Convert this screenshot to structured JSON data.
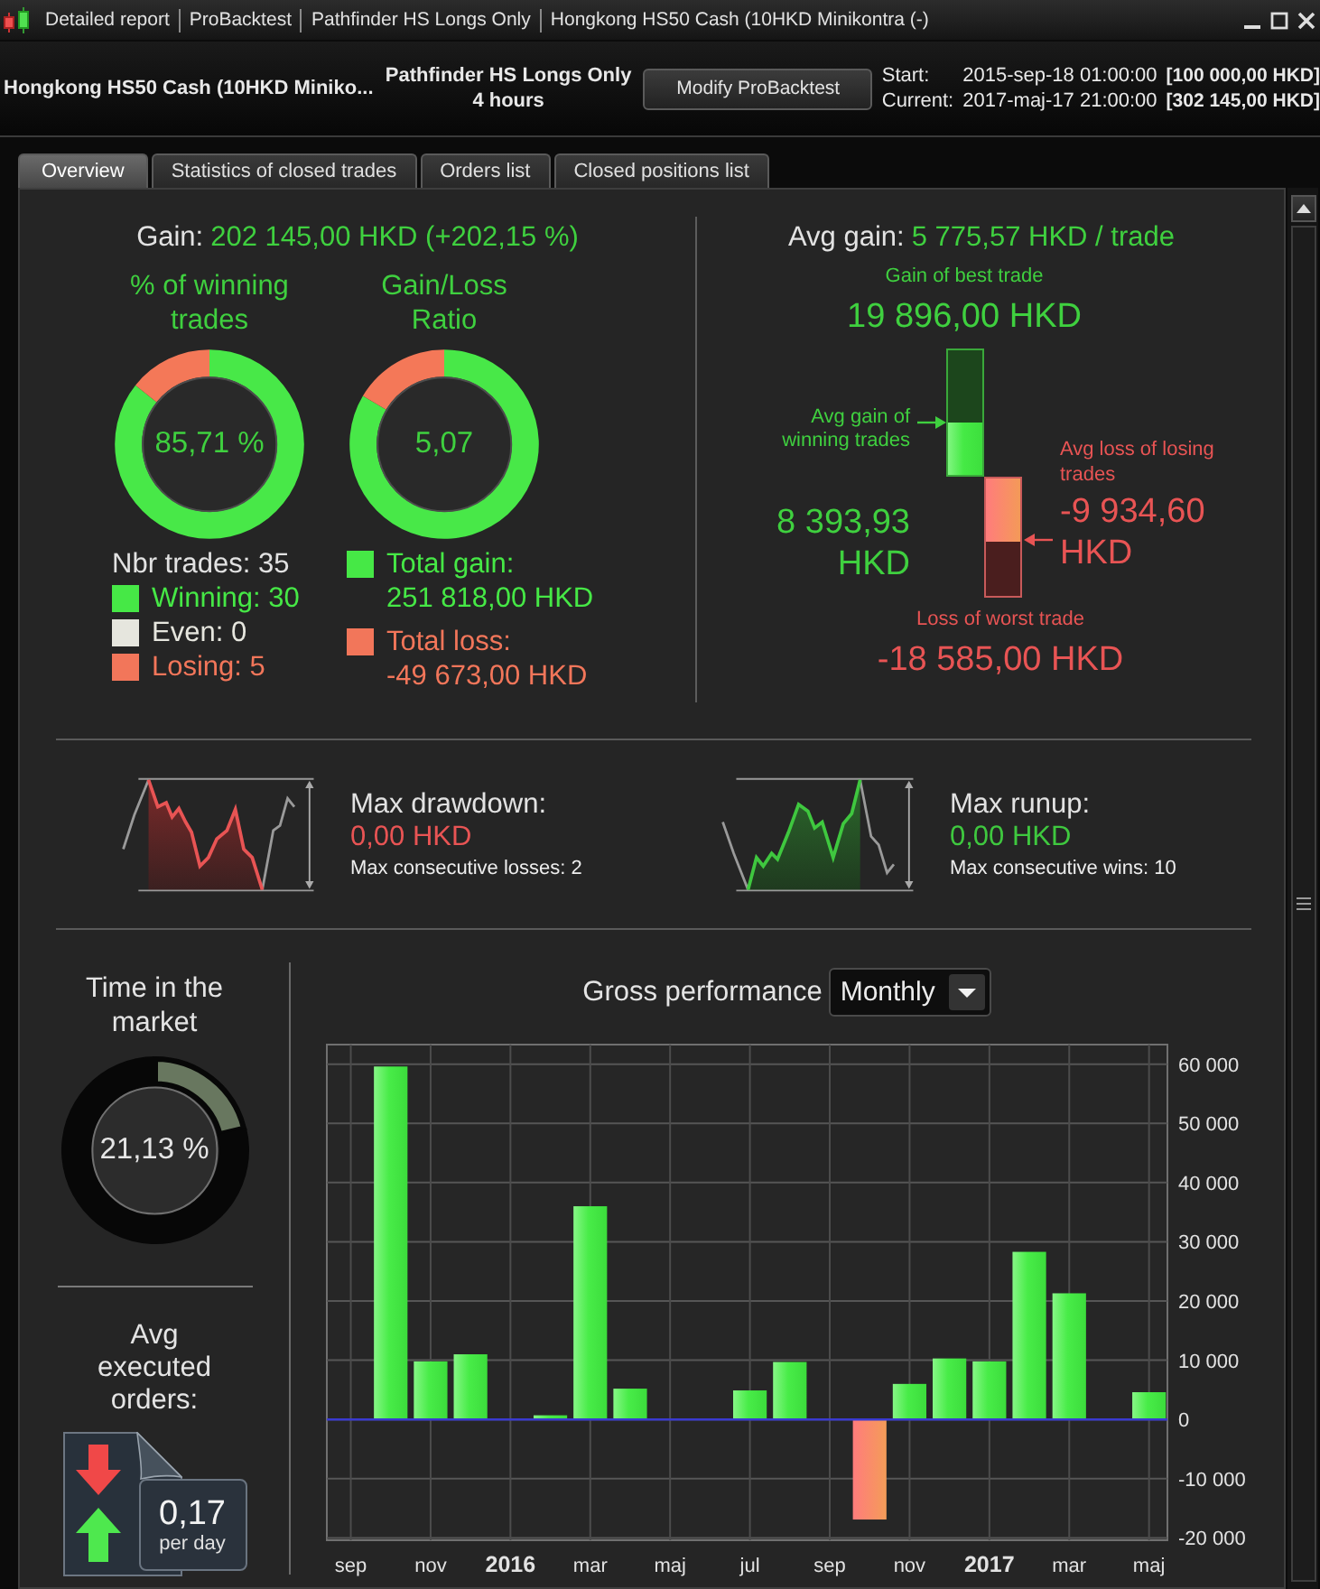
{
  "window": {
    "title_segments": [
      "Detailed report",
      "ProBacktest",
      "Pathfinder HS Longs Only",
      "Hongkong HS50 Cash (10HKD Minikontra (-)"
    ]
  },
  "header": {
    "instrument": "Hongkong HS50 Cash (10HKD Miniko...",
    "system": "Pathfinder HS Longs Only",
    "timeframe": "4 hours",
    "button": "Modify ProBacktest",
    "periods": [
      {
        "label": "Start:",
        "date": "2015-sep-18 01:00:00",
        "capital": "[100 000,00 HKD]"
      },
      {
        "label": "Current:",
        "date": "2017-maj-17 21:00:00",
        "capital": "[302 145,00 HKD]"
      }
    ]
  },
  "tabs": [
    {
      "label": "Overview",
      "selected": true
    },
    {
      "label": "Statistics of closed trades",
      "selected": false
    },
    {
      "label": "Orders list",
      "selected": false
    },
    {
      "label": "Closed positions list",
      "selected": false
    }
  ],
  "summary": {
    "gain_label": "Gain:",
    "gain_value": "202 145,00 HKD (+202,15 %)",
    "gauges": [
      {
        "title": "% of winning trades",
        "reading": "85,71 %",
        "chart_data": {
          "type": "donut",
          "values": [
            85.71,
            14.29
          ]
        }
      },
      {
        "title": "Gain/Loss Ratio",
        "reading": "5,07",
        "chart_data": {
          "type": "donut",
          "values": [
            83.53,
            16.47
          ]
        }
      }
    ],
    "trade_count": "Nbr trades: 35",
    "trade_types": [
      {
        "label": "Winning: 30",
        "color": "#46e846"
      },
      {
        "label": "Even: 0",
        "color": "#e6e6de"
      },
      {
        "label": "Losing: 5",
        "color": "#f2765a"
      }
    ],
    "totals": [
      {
        "label": "Total gain:",
        "value": "251 818,00 HKD",
        "color": "#46e846"
      },
      {
        "label": "Total loss:",
        "value": "-49 673,00 HKD",
        "color": "#f2765a"
      }
    ]
  },
  "avg_trade": {
    "label": "Avg gain:",
    "value": "5 775,57 HKD / trade",
    "best": {
      "label": "Gain of best trade",
      "value": "19 896,00 HKD"
    },
    "avg_win": {
      "label": "Avg gain of winning trades",
      "value": "8 393,93 HKD",
      "level": 0.4219
    },
    "avg_loss": {
      "label": "Avg loss of losing trades",
      "value": "-9 934,60 HKD",
      "level": 0.5346
    },
    "worst": {
      "label": "Loss of worst trade",
      "value": "-18 585,00 HKD"
    }
  },
  "extremes": [
    {
      "kind": "drawdown",
      "title": "Max drawdown:",
      "value": "0,00 HKD",
      "note": "Max consecutive losses: 2"
    },
    {
      "kind": "runup",
      "title": "Max runup:",
      "value": "0,00 HKD",
      "note": "Max consecutive wins: 10"
    }
  ],
  "time_in_market": {
    "title": "Time in the market",
    "reading": "21,13 %",
    "chart_data": {
      "type": "donut",
      "values": [
        21.13,
        78.87
      ]
    }
  },
  "executed_orders": {
    "title": "Avg executed orders:",
    "value": "0,17",
    "unit": "per day"
  },
  "gross_performance": {
    "period": "Monthly",
    "chart_data": {
      "type": "bar",
      "title": "Gross performance",
      "categories": [
        "sep",
        null,
        "nov",
        null,
        "2016",
        null,
        "mar",
        null,
        "maj",
        null,
        "jul",
        null,
        "sep",
        null,
        "nov",
        null,
        "2017",
        null,
        "mar",
        null,
        "maj"
      ],
      "values": [
        null,
        59600,
        9800,
        11000,
        null,
        700,
        36000,
        5200,
        null,
        null,
        4900,
        9700,
        null,
        -16900,
        6000,
        10300,
        9800,
        28300,
        21300,
        null,
        4600
      ],
      "ylim": [
        -20400,
        63300
      ],
      "yticks": [
        {
          "value": -20000,
          "label": "-20 000"
        },
        {
          "value": -10000,
          "label": "-10 000"
        },
        {
          "value": 0,
          "label": "0"
        },
        {
          "value": 10000,
          "label": "10 000"
        },
        {
          "value": 20000,
          "label": "20 000"
        },
        {
          "value": 30000,
          "label": "30 000"
        },
        {
          "value": 40000,
          "label": "40 000"
        },
        {
          "value": 50000,
          "label": "50 000"
        },
        {
          "value": 60000,
          "label": "60 000"
        }
      ],
      "grid": true,
      "ref_lines": [
        {
          "axis": "y",
          "value": 0,
          "color": "#3a3ad0"
        }
      ]
    }
  }
}
